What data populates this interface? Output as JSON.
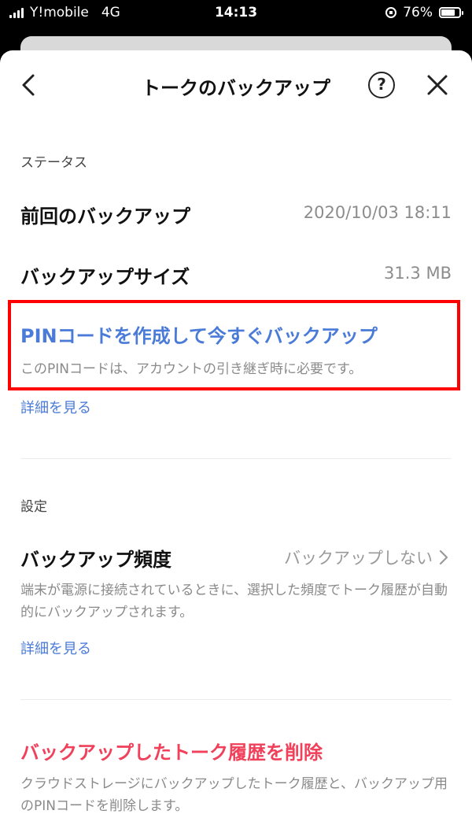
{
  "status_bar": {
    "carrier": "Y!mobile",
    "network": "4G",
    "time": "14:13",
    "battery": "76%",
    "battery_level": 0.76
  },
  "header": {
    "title": "トークのバックアップ",
    "help_label": "?"
  },
  "status_section": {
    "label": "ステータス",
    "last_backup_label": "前回のバックアップ",
    "last_backup_value": "2020/10/03 18:11",
    "size_label": "バックアップサイズ",
    "size_value": "31.3 MB",
    "pin_action": "PINコードを作成して今すぐバックアップ",
    "pin_description": "このPINコードは、アカウントの引き継ぎ時に必要です。",
    "details_link": "詳細を見る"
  },
  "settings_section": {
    "label": "設定",
    "frequency_label": "バックアップ頻度",
    "frequency_value": "バックアップしない",
    "frequency_description": "端末が電源に接続されているときに、選択した頻度でトーク履歴が自動的にバックアップされます。",
    "details_link": "詳細を見る"
  },
  "delete_section": {
    "action": "バックアップしたトーク履歴を削除",
    "description": "クラウドストレージにバックアップしたトーク履歴と、バックアップ用のPINコードを削除します。"
  },
  "colors": {
    "link": "#4a7bd8",
    "danger": "#f0405a",
    "highlight_border": "#ff0000"
  }
}
